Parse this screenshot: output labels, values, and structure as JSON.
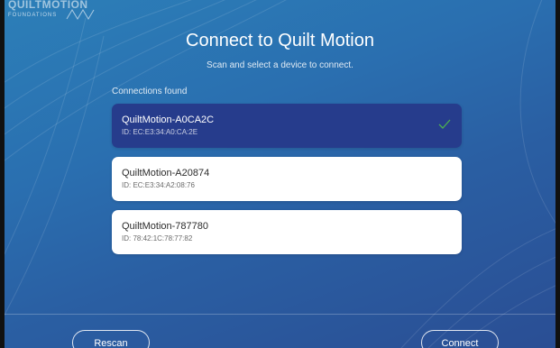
{
  "brand": {
    "name": "QUILTMOTION",
    "sub": "FOUNDATIONS"
  },
  "header": {
    "title": "Connect to Quilt Motion",
    "subtitle": "Scan and select a device to connect."
  },
  "connections": {
    "label": "Connections found",
    "items": [
      {
        "name": "QuiltMotion-A0CA2C",
        "id": "ID: EC:E3:34:A0:CA:2E",
        "selected": true
      },
      {
        "name": "QuiltMotion-A20874",
        "id": "ID: EC:E3:34:A2:08:76",
        "selected": false
      },
      {
        "name": "QuiltMotion-787780",
        "id": "ID: 78:42:1C:78:77:82",
        "selected": false
      }
    ]
  },
  "footer": {
    "rescan_label": "Rescan",
    "connect_label": "Connect"
  },
  "colors": {
    "selected_bg": "#263c8c",
    "check": "#4caf50"
  },
  "icons": {
    "check": "check-icon",
    "logo": "quilt-logo-icon"
  }
}
